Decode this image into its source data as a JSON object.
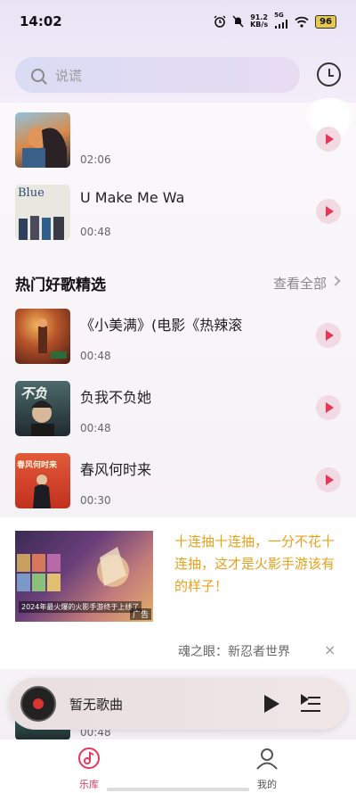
{
  "status_bar": {
    "time": "14:02",
    "net_speed_value": "91.2",
    "net_speed_unit": "KB/s",
    "signal_label": "5G",
    "battery": "96"
  },
  "search": {
    "placeholder": "说谎"
  },
  "top_songs": [
    {
      "title": "",
      "duration": "02:06",
      "cover_colors": [
        "#6fa7c9",
        "#d98a4a",
        "#2b2b33"
      ]
    },
    {
      "title": "U Make Me Wa",
      "duration": "00:48",
      "cover_text": "Blue",
      "cover_colors": [
        "#e7e6df",
        "#2f4b7c"
      ]
    }
  ],
  "hot_section": {
    "title": "热门好歌精选",
    "see_all": "查看全部"
  },
  "hot_songs": [
    {
      "title": "《小美满》(电影《热辣滚",
      "duration": "00:48",
      "cover_colors": [
        "#7a2a1a",
        "#d98b3a"
      ]
    },
    {
      "title": "负我不负她",
      "duration": "00:48",
      "cover_text": "不负",
      "cover_colors": [
        "#2a3a3a",
        "#5f7a7a"
      ]
    },
    {
      "title": "春风何时来",
      "duration": "00:30",
      "cover_text": "春风何时来",
      "cover_colors": [
        "#c83a2a",
        "#e26a3a"
      ]
    }
  ],
  "ad": {
    "text": "十连抽十连抽，一分不花十连抽，这才是火影手游该有的样子！",
    "image_caption": "2024年最火爆的火影手游终于上线了",
    "tag": "广告",
    "source": "魂之眼：新忍者世界",
    "close": "×"
  },
  "peek_song": {
    "duration": "00:48"
  },
  "player": {
    "title": "暂无歌曲"
  },
  "tabs": [
    {
      "label": "乐库",
      "active": true
    },
    {
      "label": "我的",
      "active": false
    }
  ],
  "colors": {
    "accent": "#e8365a",
    "play_bg": "#f1dae1",
    "ad_text": "#e8a11b"
  }
}
